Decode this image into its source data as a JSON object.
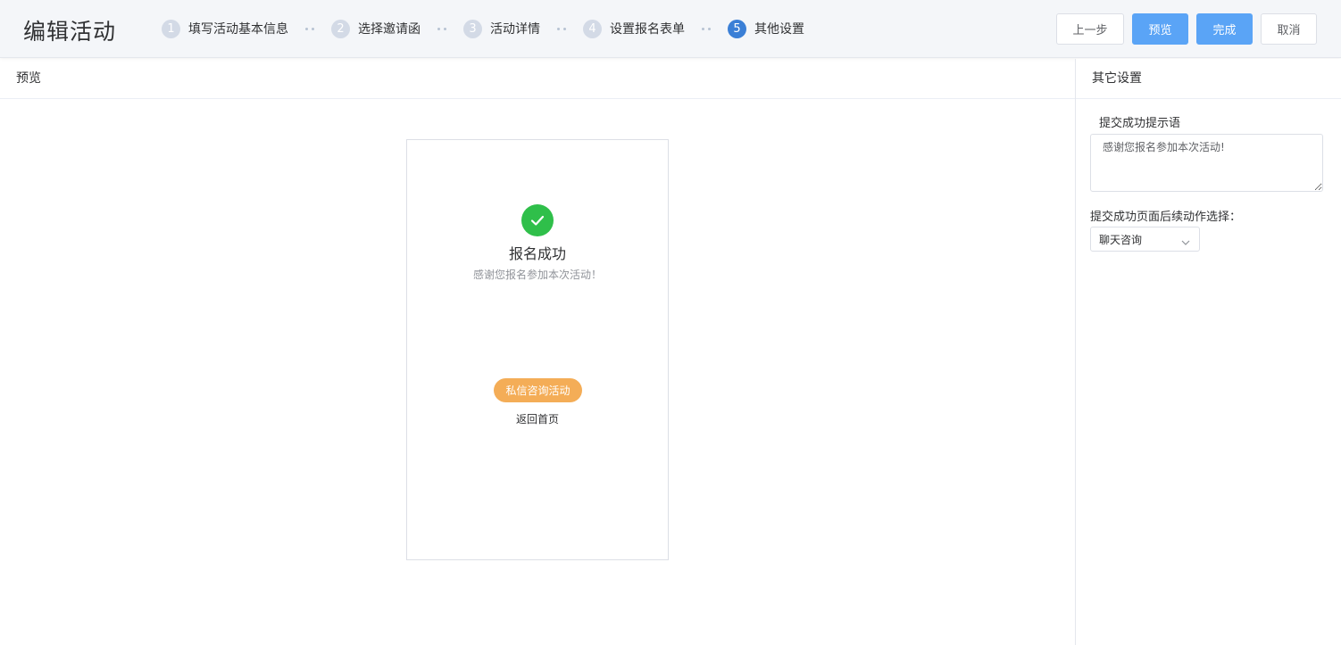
{
  "header": {
    "title": "编辑活动",
    "steps": [
      {
        "num": "1",
        "label": "填写活动基本信息"
      },
      {
        "num": "2",
        "label": "选择邀请函"
      },
      {
        "num": "3",
        "label": "活动详情"
      },
      {
        "num": "4",
        "label": "设置报名表单"
      },
      {
        "num": "5",
        "label": "其他设置"
      }
    ],
    "active_step": "5",
    "buttons": {
      "prev": "上一步",
      "preview": "预览",
      "finish": "完成",
      "cancel": "取消"
    }
  },
  "preview_panel": {
    "title": "预览",
    "phone": {
      "success_title": "报名成功",
      "success_message": "感谢您报名参加本次活动！",
      "consult_button": "私信咨询活动",
      "back_home": "返回首页"
    }
  },
  "settings_panel": {
    "title": "其它设置",
    "tip_label": "提交成功提示语",
    "tip_value": "感谢您报名参加本次活动!",
    "action_label": "提交成功页面后续动作选择：",
    "action_selected": "聊天咨询"
  },
  "colors": {
    "primary": "#5aa4f6",
    "active_step": "#3a7fd6",
    "success": "#2fbf4a",
    "consult_button": "#f4ad57"
  }
}
